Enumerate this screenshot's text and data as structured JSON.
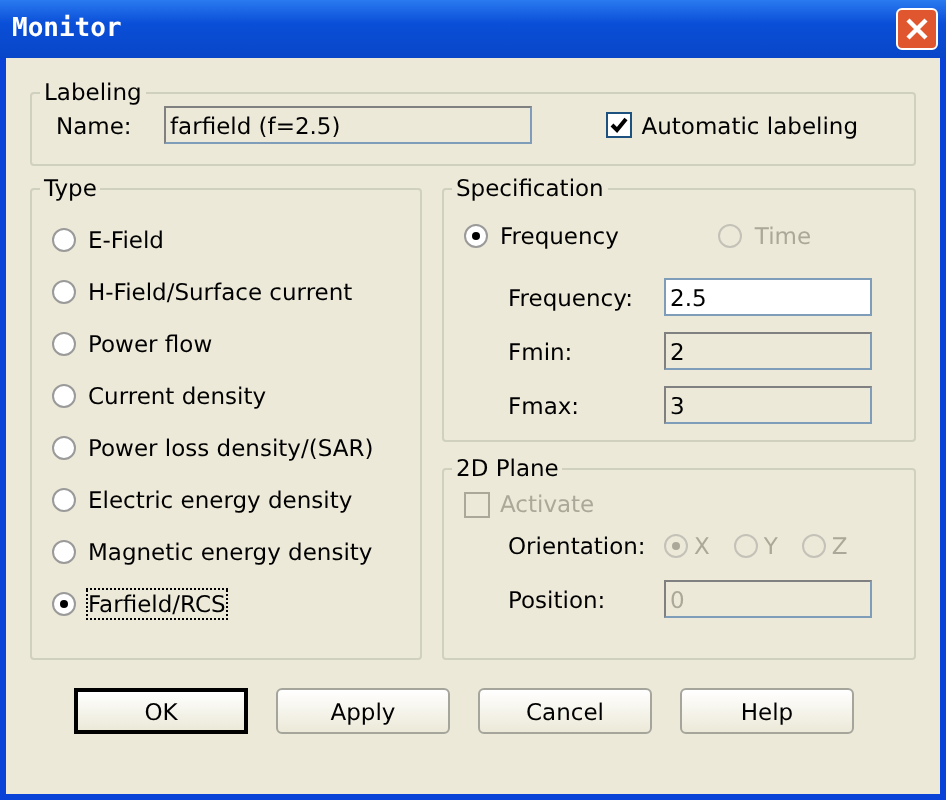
{
  "window": {
    "title": "Monitor"
  },
  "labeling": {
    "legend": "Labeling",
    "name_label": "Name:",
    "name_value": "farfield (f=2.5)",
    "name_disabled": true,
    "auto": {
      "label": "Automatic labeling",
      "checked": true
    }
  },
  "type": {
    "legend": "Type",
    "options": [
      {
        "label": "E-Field",
        "selected": false
      },
      {
        "label": "H-Field/Surface current",
        "selected": false
      },
      {
        "label": "Power flow",
        "selected": false
      },
      {
        "label": "Current density",
        "selected": false
      },
      {
        "label": "Power loss density/(SAR)",
        "selected": false
      },
      {
        "label": "Electric energy density",
        "selected": false
      },
      {
        "label": "Magnetic energy density",
        "selected": false
      },
      {
        "label": "Farfield/RCS",
        "selected": true
      }
    ]
  },
  "specification": {
    "legend": "Specification",
    "modes": [
      {
        "label": "Frequency",
        "selected": true,
        "disabled": false
      },
      {
        "label": "Time",
        "selected": false,
        "disabled": true
      }
    ],
    "fields": [
      {
        "label": "Frequency:",
        "value": "2.5",
        "disabled": false
      },
      {
        "label": "Fmin:",
        "value": "2",
        "disabled": true
      },
      {
        "label": "Fmax:",
        "value": "3",
        "disabled": true
      }
    ]
  },
  "plane": {
    "legend": "2D Plane",
    "disabled": true,
    "activate": {
      "label": "Activate",
      "checked": false
    },
    "orientation_label": "Orientation:",
    "axes": [
      {
        "label": "X",
        "selected": true
      },
      {
        "label": "Y",
        "selected": false
      },
      {
        "label": "Z",
        "selected": false
      }
    ],
    "position_label": "Position:",
    "position_value": "0"
  },
  "buttons": [
    {
      "label": "OK",
      "default": true
    },
    {
      "label": "Apply",
      "default": false
    },
    {
      "label": "Cancel",
      "default": false
    },
    {
      "label": "Help",
      "default": false
    }
  ]
}
